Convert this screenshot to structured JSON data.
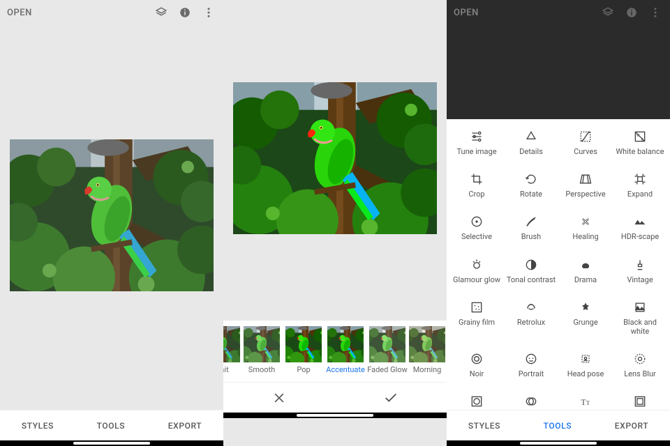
{
  "header": {
    "open_label": "OPEN"
  },
  "bottom_tabs": {
    "styles": "STYLES",
    "tools": "TOOLS",
    "export": "EXPORT"
  },
  "looks": {
    "items": [
      {
        "label": "Portrait",
        "partial": true
      },
      {
        "label": "Smooth"
      },
      {
        "label": "Pop"
      },
      {
        "label": "Accentuate",
        "selected": true
      },
      {
        "label": "Faded Glow"
      },
      {
        "label": "Morning",
        "partial_right": true
      }
    ]
  },
  "tools_grid": [
    [
      {
        "id": "tune",
        "label": "Tune image"
      },
      {
        "id": "details",
        "label": "Details"
      },
      {
        "id": "curves",
        "label": "Curves"
      },
      {
        "id": "wb",
        "label": "White balance"
      }
    ],
    [
      {
        "id": "crop",
        "label": "Crop"
      },
      {
        "id": "rotate",
        "label": "Rotate"
      },
      {
        "id": "perspective",
        "label": "Perspective"
      },
      {
        "id": "expand",
        "label": "Expand"
      }
    ],
    [
      {
        "id": "selective",
        "label": "Selective"
      },
      {
        "id": "brush",
        "label": "Brush"
      },
      {
        "id": "healing",
        "label": "Healing"
      },
      {
        "id": "hdr",
        "label": "HDR-scape"
      }
    ],
    [
      {
        "id": "glamour",
        "label": "Glamour glow"
      },
      {
        "id": "tonal",
        "label": "Tonal contrast"
      },
      {
        "id": "drama",
        "label": "Drama"
      },
      {
        "id": "vintage",
        "label": "Vintage"
      }
    ],
    [
      {
        "id": "grainy",
        "label": "Grainy film"
      },
      {
        "id": "retrolux",
        "label": "Retrolux"
      },
      {
        "id": "grunge",
        "label": "Grunge"
      },
      {
        "id": "bw",
        "label": "Black and white"
      }
    ],
    [
      {
        "id": "noir",
        "label": "Noir"
      },
      {
        "id": "portrait",
        "label": "Portrait"
      },
      {
        "id": "headpose",
        "label": "Head pose"
      },
      {
        "id": "lensblur",
        "label": "Lens Blur"
      }
    ],
    [
      {
        "id": "vignette",
        "label": "Vignette",
        "partial": true
      },
      {
        "id": "doubleexp",
        "label": "Double exposure",
        "partial": true
      },
      {
        "id": "text",
        "label": "Text",
        "partial": true
      },
      {
        "id": "frames",
        "label": "Frames",
        "partial": true
      }
    ]
  ],
  "pane3_active_tab": "tools"
}
